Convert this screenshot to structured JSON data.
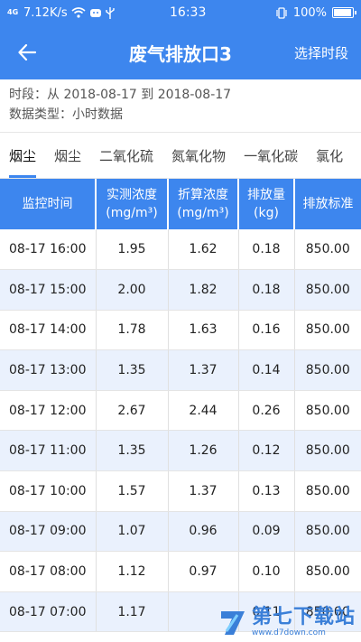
{
  "status": {
    "network": "4G",
    "speed": "7.12K/s",
    "time": "16:33",
    "battery": "100%",
    "battery_level": 1.0
  },
  "appbar": {
    "title": "废气排放口3",
    "action": "选择时段"
  },
  "info": {
    "period": "时段：从 2018-08-17 到 2018-08-17",
    "datatype": "数据类型：小时数据"
  },
  "tabs": [
    "烟尘",
    "烟尘",
    "二氧化硫",
    "氮氧化物",
    "一氧化碳",
    "氯化"
  ],
  "table": {
    "headers": [
      {
        "l1": "监控时间",
        "l2": ""
      },
      {
        "l1": "实测浓度",
        "l2": "(mg/m³)"
      },
      {
        "l1": "折算浓度",
        "l2": "(mg/m³)"
      },
      {
        "l1": "排放量",
        "l2": "(kg)"
      },
      {
        "l1": "排放标准",
        "l2": ""
      }
    ],
    "rows": [
      [
        "08-17 16:00",
        "1.95",
        "1.62",
        "0.18",
        "850.00"
      ],
      [
        "08-17 15:00",
        "2.00",
        "1.82",
        "0.18",
        "850.00"
      ],
      [
        "08-17 14:00",
        "1.78",
        "1.63",
        "0.16",
        "850.00"
      ],
      [
        "08-17 13:00",
        "1.35",
        "1.37",
        "0.14",
        "850.00"
      ],
      [
        "08-17 12:00",
        "2.67",
        "2.44",
        "0.26",
        "850.00"
      ],
      [
        "08-17 11:00",
        "1.35",
        "1.26",
        "0.12",
        "850.00"
      ],
      [
        "08-17 10:00",
        "1.57",
        "1.37",
        "0.13",
        "850.00"
      ],
      [
        "08-17 09:00",
        "1.07",
        "0.96",
        "0.09",
        "850.00"
      ],
      [
        "08-17 08:00",
        "1.12",
        "0.97",
        "0.10",
        "850.00"
      ],
      [
        "08-17 07:00",
        "1.17",
        "",
        "0.11",
        "850.00"
      ]
    ]
  },
  "watermark": {
    "name": "第七下载站",
    "url": "www.d7down.com"
  },
  "colors": {
    "primary": "#3d86ee",
    "row_alt": "#eaf1fd"
  }
}
